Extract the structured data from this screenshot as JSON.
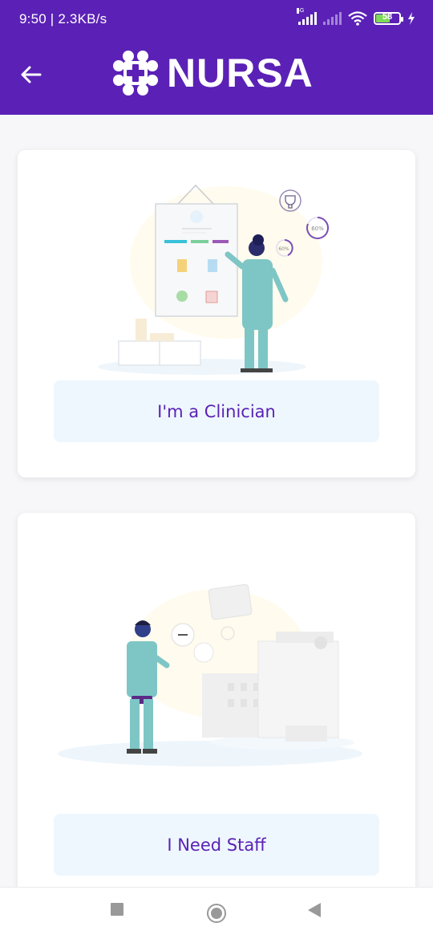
{
  "status_bar": {
    "time_speed": "9:50 | 2.3KB/s",
    "network": "4G",
    "battery": "58"
  },
  "app_bar": {
    "brand": "NURSA"
  },
  "cards": {
    "clinician": {
      "button_label": "I'm a Clinician",
      "progress_a": "60%",
      "progress_b": "60%"
    },
    "staff": {
      "button_label": "I Need Staff"
    }
  },
  "colors": {
    "primary": "#5b21b6",
    "button_bg": "#eef7fd"
  },
  "icons": [
    "back-arrow-icon",
    "nursa-logo-icon",
    "recents-icon",
    "home-icon",
    "back-nav-icon"
  ]
}
